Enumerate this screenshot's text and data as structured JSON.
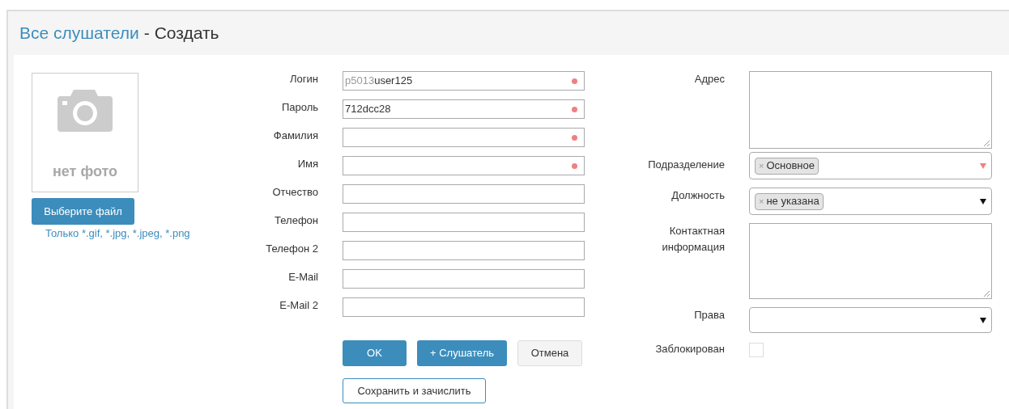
{
  "header": {
    "breadcrumb": "Все слушатели",
    "separator": "-",
    "title": "Создать"
  },
  "photo": {
    "placeholder_text": "нет фото",
    "button": "Выберите файл",
    "hint": "Только *.gif, *.jpg, *.jpeg, *.png"
  },
  "fields": [
    {
      "label": "Логин",
      "prefix": "p5013",
      "value": "user125",
      "required": true
    },
    {
      "label": "Пароль",
      "value": "712dcc28",
      "required": true
    },
    {
      "label": "Фамилия",
      "required": true
    },
    {
      "label": "Имя",
      "required": true
    },
    {
      "label": "Отчество",
      "required": false
    },
    {
      "label": "Телефон",
      "required": false
    },
    {
      "label": "Телефон 2",
      "required": false
    },
    {
      "label": "E-Mail",
      "required": false
    },
    {
      "label": "E-Mail 2",
      "required": false
    }
  ],
  "buttons": [
    {
      "label": "OK",
      "kind": "primary"
    },
    {
      "label": "+ Слушатель",
      "kind": "primary"
    },
    {
      "label": "Отмена",
      "kind": "default"
    }
  ],
  "save_button": {
    "label": "Сохранить и зачислить"
  },
  "side_fields": [
    {
      "label": "Адрес",
      "kind": "textarea"
    },
    {
      "label": "Подразделение",
      "kind": "tags",
      "required": true,
      "tags": [
        {
          "remove": "×",
          "text": "Основное"
        }
      ]
    },
    {
      "label": "Должность",
      "kind": "tags",
      "required": false,
      "tags": [
        {
          "remove": "×",
          "text": "не указана"
        }
      ]
    },
    {
      "label": "Контактная информация",
      "kind": "textarea"
    },
    {
      "label": "Права",
      "kind": "select",
      "required": false
    },
    {
      "label": "Заблокирован",
      "kind": "checkbox",
      "checked": false
    }
  ]
}
